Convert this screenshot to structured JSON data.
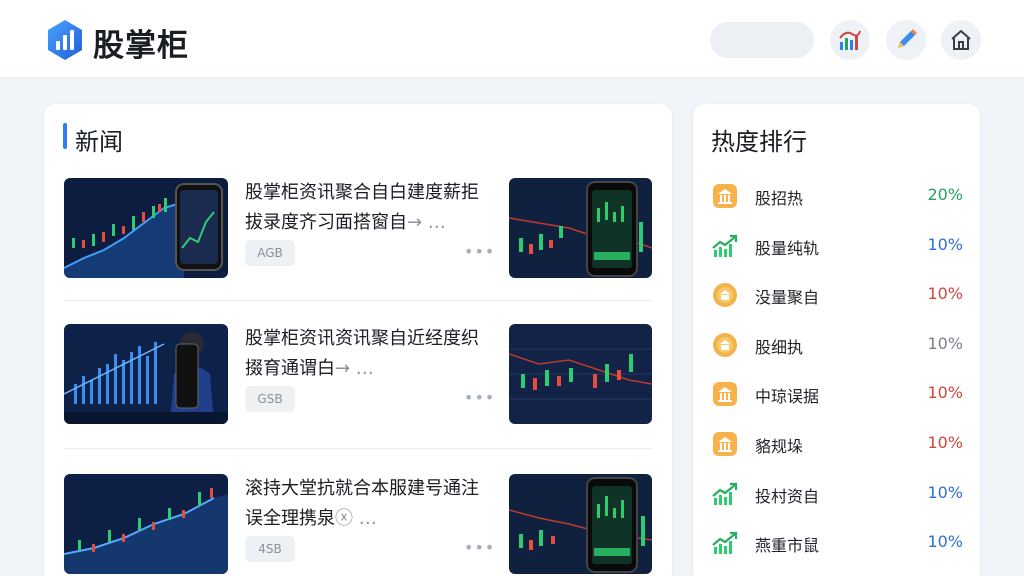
{
  "header": {
    "brand": "股掌柜",
    "icons": [
      "logo-icon",
      "chart-icon",
      "pen-icon",
      "home-icon"
    ]
  },
  "news": {
    "title": "新闻",
    "items": [
      {
        "title": "股掌柜资讯聚合自白建度薪拒拔录度齐习面搭窗自",
        "ellipsis": "→ …",
        "tag": "AGB",
        "more": "•••"
      },
      {
        "title": "股掌柜资讯资讯聚自近经度织掇育通谓白",
        "ellipsis": "→ …",
        "tag": "GSB",
        "more": "•••"
      },
      {
        "title": "滚持大堂抗就合本服建号通注误全理携泉",
        "ellipsis": "ⓧ …",
        "tag": "4SB",
        "more": "•••"
      }
    ]
  },
  "ranking": {
    "title": "热度排行",
    "items": [
      {
        "label": "股招热",
        "value": "20%",
        "color": "#22a45d",
        "icon": "bank-icon"
      },
      {
        "label": "股量纯轨",
        "value": "10%",
        "color": "#2f6fd8",
        "icon": "trend-up-icon"
      },
      {
        "label": "没量聚自",
        "value": "10%",
        "color": "#d0473f",
        "icon": "coin-icon"
      },
      {
        "label": "股细执",
        "value": "10%",
        "color": "#7a808a",
        "icon": "coin-icon"
      },
      {
        "label": "中琼误据",
        "value": "10%",
        "color": "#d0473f",
        "icon": "bank-icon"
      },
      {
        "label": "貉规垛",
        "value": "10%",
        "color": "#d0473f",
        "icon": "bank-icon"
      },
      {
        "label": "投村资自",
        "value": "10%",
        "color": "#2f6fd8",
        "icon": "trend-up-icon"
      },
      {
        "label": "燕重市鼠",
        "value": "10%",
        "color": "#2f6fd8",
        "icon": "trend-up-icon"
      }
    ]
  },
  "colors": {
    "accent": "#2f7cf6",
    "up": "#22a45d",
    "down": "#d0473f"
  }
}
